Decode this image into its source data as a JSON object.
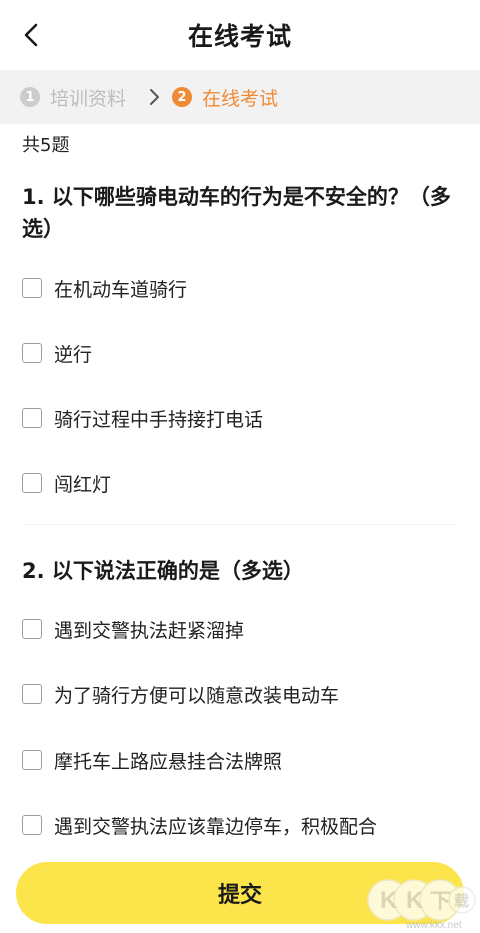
{
  "header": {
    "title": "在线考试",
    "back_icon": "chevron-left-icon"
  },
  "steps": [
    {
      "num": "1",
      "label": "培训资料",
      "state": "done"
    },
    {
      "num": "2",
      "label": "在线考试",
      "state": "active"
    }
  ],
  "colors": {
    "accent": "#ef8a35",
    "submit": "#fbe54a",
    "steps_bg": "#f2f2f2",
    "inactive": "#bdbdbd"
  },
  "count_label": "共5题",
  "questions": [
    {
      "title": "1. 以下哪些骑电动车的行为是不安全的？（多选）",
      "options": [
        {
          "label": "在机动车道骑行",
          "checked": false
        },
        {
          "label": "逆行",
          "checked": false
        },
        {
          "label": "骑行过程中手持接打电话",
          "checked": false
        },
        {
          "label": "闯红灯",
          "checked": false
        }
      ]
    },
    {
      "title": "2. 以下说法正确的是（多选）",
      "options": [
        {
          "label": "遇到交警执法赶紧溜掉",
          "checked": false
        },
        {
          "label": "为了骑行方便可以随意改装电动车",
          "checked": false
        },
        {
          "label": "摩托车上路应悬挂合法牌照",
          "checked": false
        },
        {
          "label": "遇到交警执法应该靠边停车，积极配合",
          "checked": false
        }
      ]
    }
  ],
  "submit_label": "提交",
  "watermark": {
    "text": "KK下载",
    "url_text": "www.kkx.net"
  }
}
